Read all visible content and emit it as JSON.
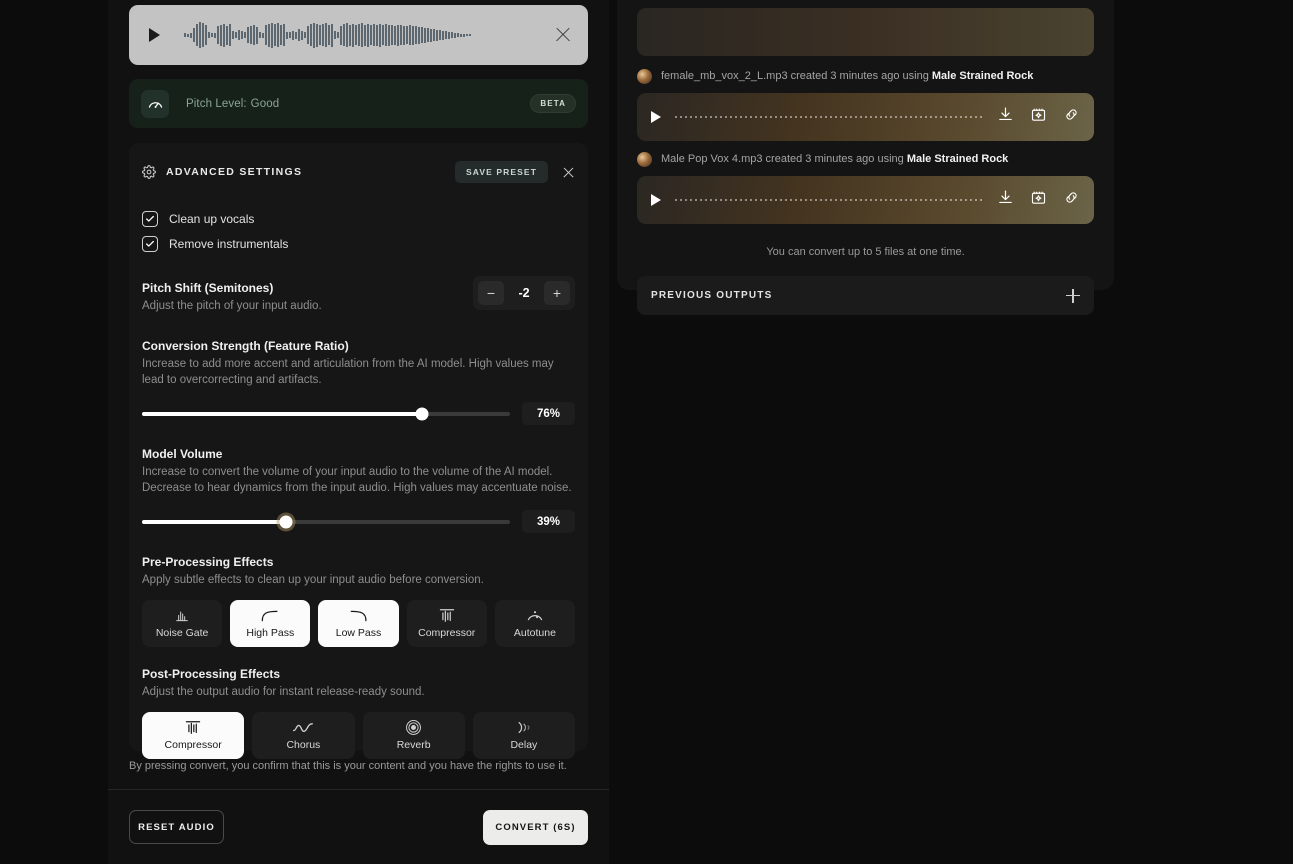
{
  "left_panel": {
    "player": {
      "play_label": "play",
      "close_label": "close",
      "waveform_bars": [
        4,
        3,
        5,
        14,
        22,
        26,
        24,
        20,
        6,
        4,
        5,
        18,
        21,
        23,
        19,
        22,
        8,
        6,
        10,
        8,
        6,
        16,
        18,
        20,
        17,
        6,
        5,
        20,
        23,
        25,
        22,
        24,
        20,
        22,
        7,
        6,
        9,
        7,
        12,
        9,
        6,
        18,
        22,
        25,
        23,
        20,
        22,
        24,
        20,
        23,
        8,
        6,
        19,
        22,
        24,
        21,
        23,
        20,
        22,
        24,
        21,
        23,
        20,
        22,
        21,
        23,
        20,
        22,
        21,
        20,
        19,
        21,
        20,
        19,
        18,
        20,
        19,
        18,
        17,
        16,
        15,
        14,
        13,
        12,
        11,
        10,
        9,
        8,
        7,
        6,
        5,
        4,
        3,
        3,
        2,
        2
      ]
    },
    "pitch": {
      "icon": "gauge-icon",
      "label": "Pitch Level:",
      "value": "Good",
      "badge": "BETA"
    },
    "advanced": {
      "icon": "gear-icon",
      "title": "ADVANCED SETTINGS",
      "save_preset": "SAVE PRESET",
      "close_label": "close",
      "checkboxes": [
        {
          "label": "Clean up vocals",
          "checked": true
        },
        {
          "label": "Remove instrumentals",
          "checked": true
        }
      ],
      "pitch_shift": {
        "title": "Pitch Shift (Semitones)",
        "desc": "Adjust the pitch of your input audio.",
        "minus": "−",
        "plus": "+",
        "value": "-2"
      },
      "conversion_strength": {
        "title": "Conversion Strength (Feature Ratio)",
        "desc": "Increase to add more accent and articulation from the AI model. High values may lead to overcorrecting and artifacts.",
        "value": "76%",
        "percent": 76
      },
      "model_volume": {
        "title": "Model Volume",
        "desc": "Increase to convert the volume of your input audio to the volume of the AI model. Decrease to hear dynamics from the input audio. High values may accentuate noise.",
        "value": "39%",
        "percent": 39
      },
      "pre_processing": {
        "title": "Pre-Processing Effects",
        "desc": "Apply subtle effects to clean up your input audio before conversion.",
        "effects": [
          {
            "label": "Noise Gate",
            "icon": "noise-gate-icon",
            "selected": false
          },
          {
            "label": "High Pass",
            "icon": "high-pass-icon",
            "selected": true
          },
          {
            "label": "Low Pass",
            "icon": "low-pass-icon",
            "selected": true
          },
          {
            "label": "Compressor",
            "icon": "compressor-icon",
            "selected": false
          },
          {
            "label": "Autotune",
            "icon": "autotune-icon",
            "selected": false
          }
        ]
      },
      "post_processing": {
        "title": "Post-Processing Effects",
        "desc": "Adjust the output audio for instant release-ready sound.",
        "effects": [
          {
            "label": "Compressor",
            "icon": "compressor-icon",
            "selected": true
          },
          {
            "label": "Chorus",
            "icon": "chorus-icon",
            "selected": false
          },
          {
            "label": "Reverb",
            "icon": "reverb-icon",
            "selected": false
          },
          {
            "label": "Delay",
            "icon": "delay-icon",
            "selected": false
          }
        ]
      }
    },
    "disclaimer": "By pressing convert, you confirm that this is your content and you have the rights to use it.",
    "reset_button": "RESET AUDIO",
    "convert_button": "CONVERT (6S)"
  },
  "right_panel": {
    "outputs": [
      {
        "filename": "female_mb_vox_2_L.mp3",
        "meta": " created 3 minutes ago using ",
        "model": "Male Strained Rock",
        "actions": [
          "download-icon",
          "add-to-collection-icon",
          "copy-link-icon"
        ]
      },
      {
        "filename": "Male Pop Vox 4.mp3",
        "meta": " created 3 minutes ago using ",
        "model": "Male Strained Rock",
        "actions": [
          "download-icon",
          "add-to-collection-icon",
          "copy-link-icon"
        ]
      }
    ],
    "limit_note": "You can convert up to 5 files at one time.",
    "previous_outputs": {
      "label": "PREVIOUS OUTPUTS",
      "expand_icon": "plus-icon"
    }
  }
}
